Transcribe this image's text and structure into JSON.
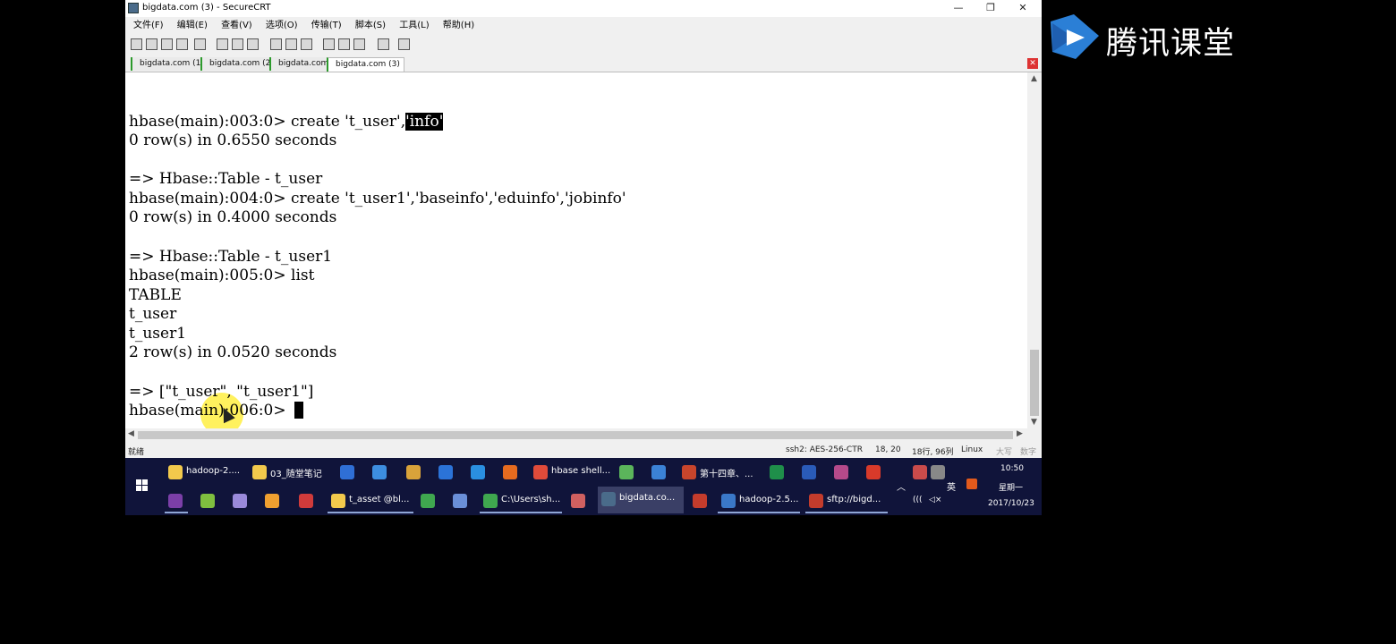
{
  "window": {
    "title": "bigdata.com (3) - SecureCRT",
    "controls": {
      "minimize": "—",
      "restore": "❐",
      "close": "✕"
    }
  },
  "menu": [
    "文件(F)",
    "编辑(E)",
    "查看(V)",
    "选项(O)",
    "传输(T)",
    "脚本(S)",
    "工具(L)",
    "帮助(H)"
  ],
  "tabs": [
    "bigdata.com (1)",
    "bigdata.com (2)",
    "bigdata.com",
    "bigdata.com (3)"
  ],
  "terminal": {
    "lines": [
      "hbase(main):003:0> create 't_user',",
      "0 row(s) in 0.6550 seconds",
      "",
      "=> Hbase::Table - t_user",
      "hbase(main):004:0> create 't_user1','baseinfo','eduinfo','jobinfo'",
      "0 row(s) in 0.4000 seconds",
      "",
      "=> Hbase::Table - t_user1",
      "hbase(main):005:0> list",
      "TABLE",
      "t_user",
      "t_user1",
      "2 row(s) in 0.0520 seconds",
      "",
      "=> [\"t_user\", \"t_user1\"]",
      "hbase(main):006:0> "
    ],
    "highlighted": "'info'"
  },
  "status": {
    "ready": "就绪",
    "cipher": "ssh2: AES-256-CTR",
    "position": "18,  20",
    "dims": "18行, 96列",
    "os": "Linux",
    "caps": "大写",
    "num": "数字"
  },
  "taskbar": {
    "row1": [
      {
        "label": "hadoop-2....",
        "color": "#f2c94c"
      },
      {
        "label": "03_随堂笔记",
        "color": "#f2c94c"
      },
      {
        "label": "",
        "color": "#2f6fd6"
      },
      {
        "label": "",
        "color": "#3d8ee0"
      },
      {
        "label": "",
        "color": "#d9a33a"
      },
      {
        "label": "",
        "color": "#2b73d8"
      },
      {
        "label": "",
        "color": "#2a8fe0"
      },
      {
        "label": "",
        "color": "#e66b1f"
      },
      {
        "label": "hbase shell...",
        "color": "#e04b3a"
      },
      {
        "label": "",
        "color": "#5bb55b"
      },
      {
        "label": "",
        "color": "#3b82d6"
      },
      {
        "label": "第十四章、...",
        "color": "#c8452c"
      },
      {
        "label": "",
        "color": "#1f8f4a"
      },
      {
        "label": "",
        "color": "#2a5bb8"
      },
      {
        "label": "",
        "color": "#b54a8a"
      },
      {
        "label": "",
        "color": "#d83a2a"
      },
      {
        "label": "",
        "color": "#c94b4b"
      },
      {
        "label": "",
        "color": "#888888"
      }
    ],
    "row2": [
      {
        "label": "",
        "color": "#7b3fa8"
      },
      {
        "label": "",
        "color": "#7fbf3f"
      },
      {
        "label": "",
        "color": "#9a8adb"
      },
      {
        "label": "",
        "color": "#f0a030"
      },
      {
        "label": "",
        "color": "#d03b3b"
      },
      {
        "label": "t_asset @bl...",
        "color": "#f2c94c"
      },
      {
        "label": "",
        "color": "#3fa84f"
      },
      {
        "label": "",
        "color": "#6a8fd8"
      },
      {
        "label": "C:\\Users\\sh...",
        "color": "#3fa84f"
      },
      {
        "label": "",
        "color": "#d06060"
      },
      {
        "label": "bigdata.co...",
        "color": "#4a6b8a"
      },
      {
        "label": "",
        "color": "#c43c2c"
      },
      {
        "label": "hadoop-2.5...",
        "color": "#3a78c8"
      },
      {
        "label": "sftp://bigd...",
        "color": "#c43c2c"
      }
    ],
    "time": "10:50",
    "weekday": "星期一",
    "date": "2017/10/23",
    "ime": "英",
    "volume": "◁×"
  },
  "brand": {
    "text": "腾讯课堂"
  }
}
